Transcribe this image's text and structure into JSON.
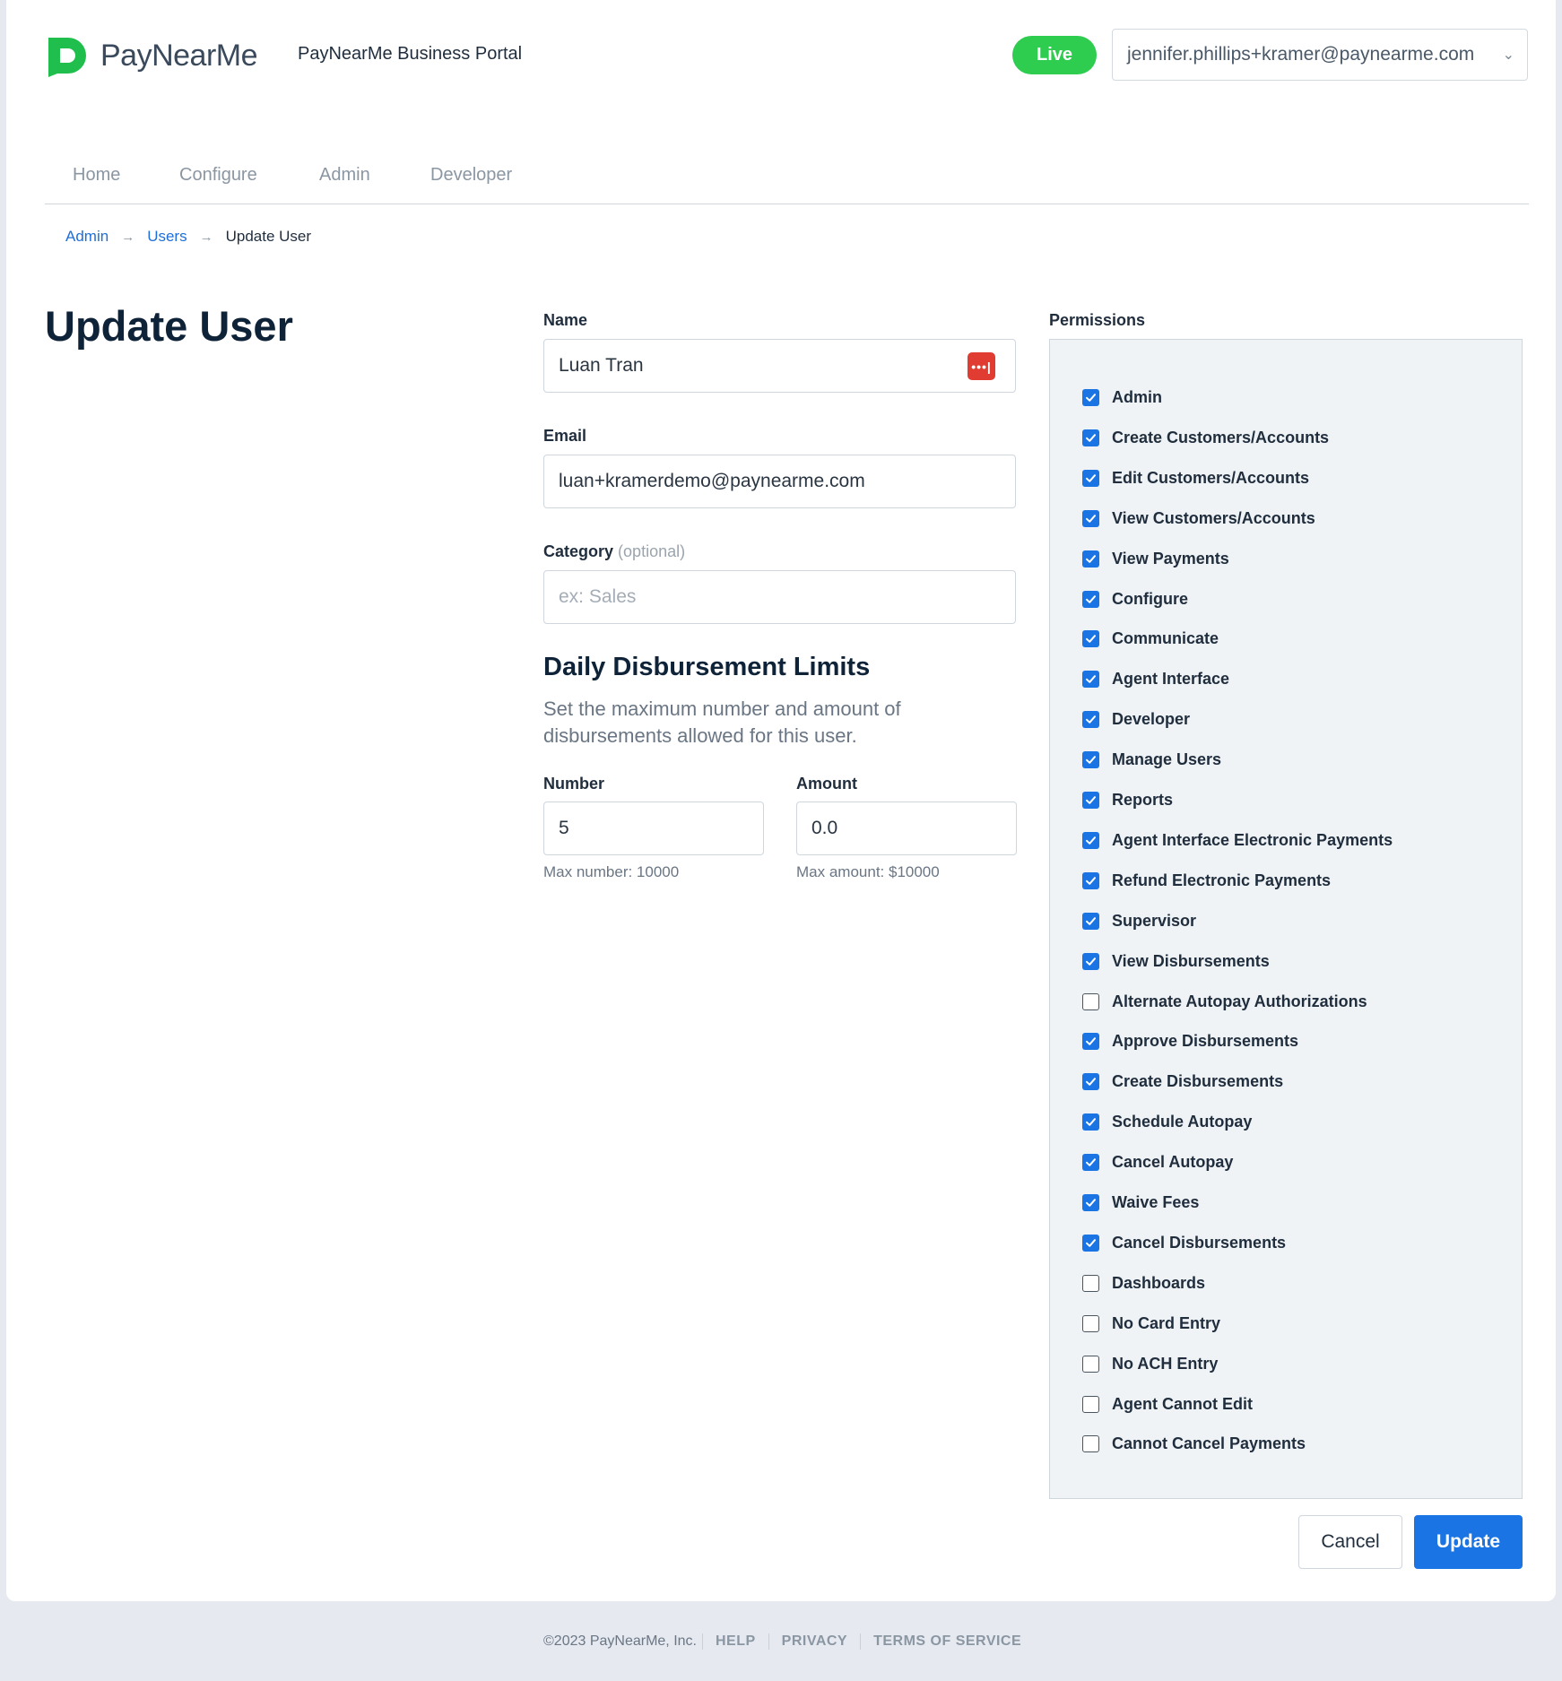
{
  "header": {
    "logo_text": "PayNearMe",
    "portal_title": "PayNearMe Business Portal",
    "mode_badge": "Live",
    "account_email": "jennifer.phillips+kramer@paynearme.com"
  },
  "nav": {
    "items": [
      "Home",
      "Configure",
      "Admin",
      "Developer"
    ]
  },
  "breadcrumb": {
    "items": [
      "Admin",
      "Users"
    ],
    "current": "Update User",
    "separator": "→"
  },
  "page": {
    "title": "Update User"
  },
  "form": {
    "name_label": "Name",
    "name_value": "Luan Tran",
    "email_label": "Email",
    "email_value": "luan+kramerdemo@paynearme.com",
    "category_label": "Category",
    "category_optional": "(optional)",
    "category_placeholder": "ex: Sales",
    "limits_title": "Daily Disbursement Limits",
    "limits_desc": "Set the maximum number and amount of disbursements allowed for this user.",
    "number_label": "Number",
    "number_value": "5",
    "number_hint": "Max number: 10000",
    "amount_label": "Amount",
    "amount_value": "0.0",
    "amount_hint": "Max amount: $10000"
  },
  "permissions": {
    "label": "Permissions",
    "items": [
      {
        "label": "Admin",
        "checked": true
      },
      {
        "label": "Create Customers/Accounts",
        "checked": true
      },
      {
        "label": "Edit Customers/Accounts",
        "checked": true
      },
      {
        "label": "View Customers/Accounts",
        "checked": true
      },
      {
        "label": "View Payments",
        "checked": true
      },
      {
        "label": "Configure",
        "checked": true
      },
      {
        "label": "Communicate",
        "checked": true
      },
      {
        "label": "Agent Interface",
        "checked": true
      },
      {
        "label": "Developer",
        "checked": true
      },
      {
        "label": "Manage Users",
        "checked": true
      },
      {
        "label": "Reports",
        "checked": true
      },
      {
        "label": "Agent Interface Electronic Payments",
        "checked": true
      },
      {
        "label": "Refund Electronic Payments",
        "checked": true
      },
      {
        "label": "Supervisor",
        "checked": true
      },
      {
        "label": "View Disbursements",
        "checked": true
      },
      {
        "label": "Alternate Autopay Authorizations",
        "checked": false
      },
      {
        "label": "Approve Disbursements",
        "checked": true
      },
      {
        "label": "Create Disbursements",
        "checked": true
      },
      {
        "label": "Schedule Autopay",
        "checked": true
      },
      {
        "label": "Cancel Autopay",
        "checked": true
      },
      {
        "label": "Waive Fees",
        "checked": true
      },
      {
        "label": "Cancel Disbursements",
        "checked": true
      },
      {
        "label": "Dashboards",
        "checked": false
      },
      {
        "label": "No Card Entry",
        "checked": false
      },
      {
        "label": "No ACH Entry",
        "checked": false
      },
      {
        "label": "Agent Cannot Edit",
        "checked": false
      },
      {
        "label": "Cannot Cancel Payments",
        "checked": false
      }
    ]
  },
  "actions": {
    "cancel_label": "Cancel",
    "update_label": "Update"
  },
  "footer": {
    "copyright": "©2023 PayNearMe, Inc.",
    "links": [
      "HELP",
      "PRIVACY",
      "TERMS OF SERVICE"
    ]
  },
  "colors": {
    "brand_green": "#2ecc4f",
    "primary_blue": "#1b74e4",
    "password_icon_red": "#e03c31"
  }
}
